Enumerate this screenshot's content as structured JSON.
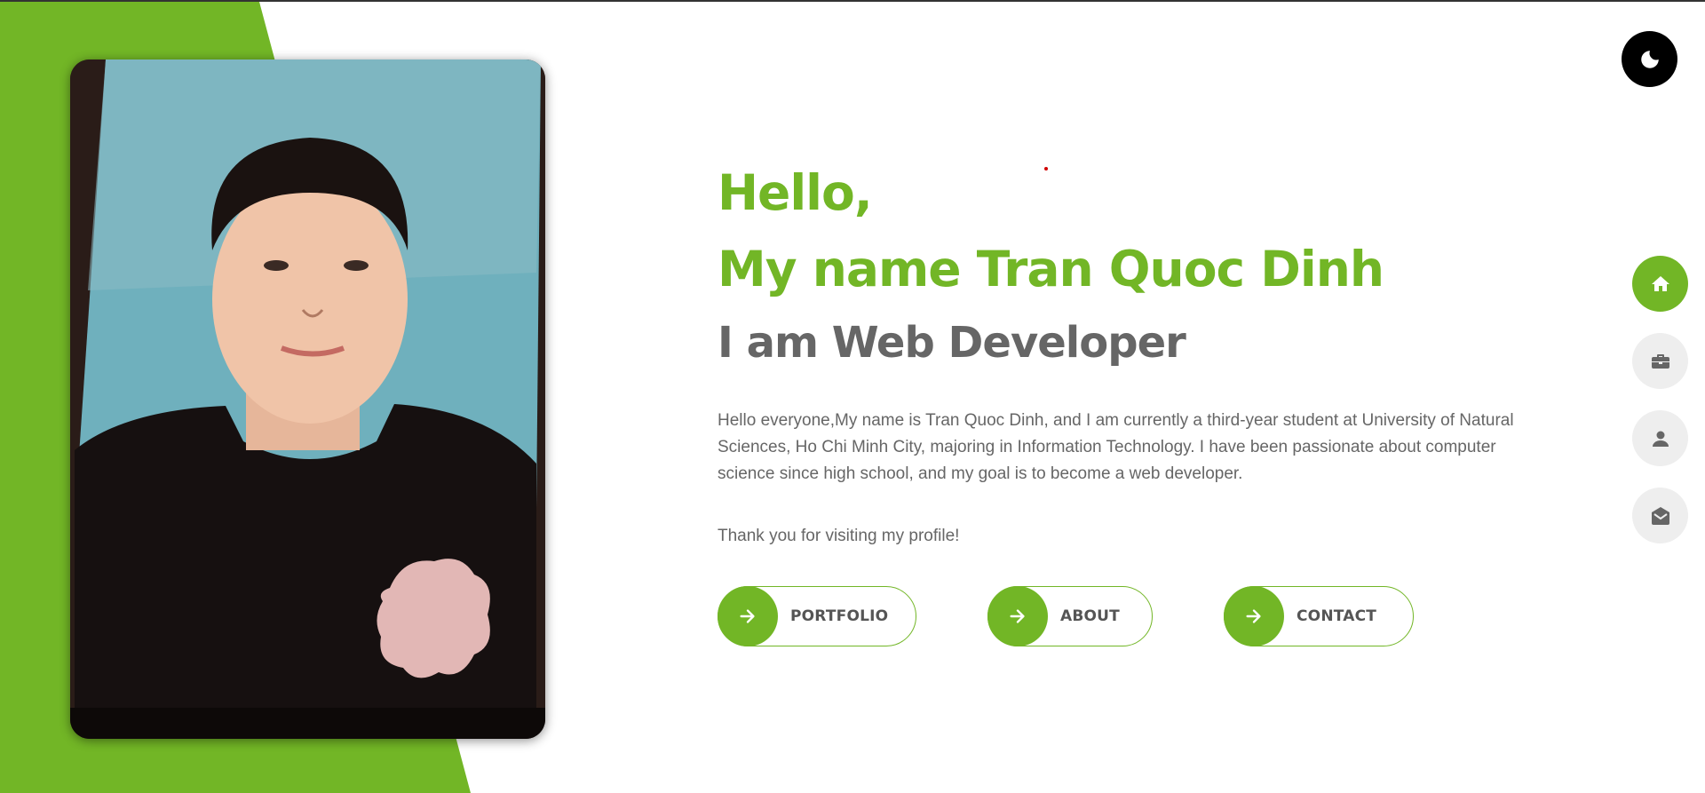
{
  "theme": {
    "accent": "#72b626",
    "text_muted": "#666666",
    "toggle_icon": "moon-icon"
  },
  "profile_photo": {
    "alt": "Profile photo"
  },
  "hero": {
    "greeting": "Hello,",
    "name_line": "My name Tran Quoc Dinh",
    "role_line": "I am Web Developer",
    "intro": "Hello everyone,My name is Tran Quoc Dinh, and I am currently a third-year student at University of Natural Sciences, Ho Chi Minh City, majoring in Information Technology. I have been passionate about computer science since high school, and my goal is to become a web developer.",
    "thanks": "Thank you for visiting my profile!"
  },
  "buttons": [
    {
      "label": "PORTFOLIO",
      "icon": "arrow-right-icon"
    },
    {
      "label": "ABOUT",
      "icon": "arrow-right-icon"
    },
    {
      "label": "CONTACT",
      "icon": "arrow-right-icon"
    }
  ],
  "side_nav": [
    {
      "icon": "home-icon",
      "active": true
    },
    {
      "icon": "briefcase-icon",
      "active": false
    },
    {
      "icon": "user-icon",
      "active": false
    },
    {
      "icon": "envelope-open-icon",
      "active": false
    }
  ]
}
